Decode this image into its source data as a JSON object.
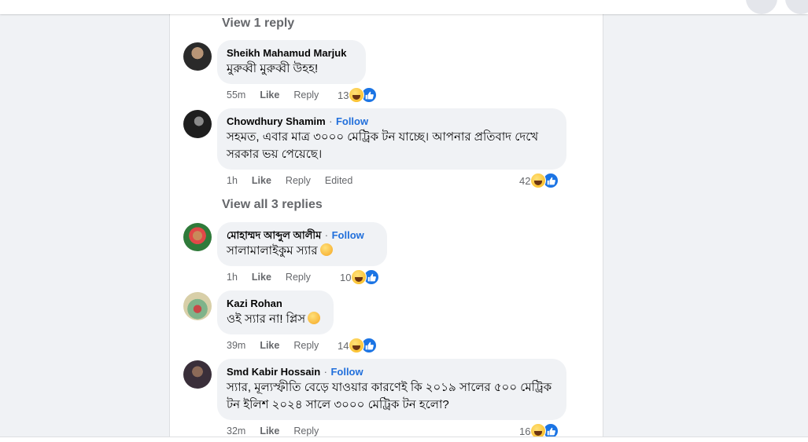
{
  "view_links": {
    "first": "View 1 reply",
    "second": "View all 3 replies"
  },
  "comments": [
    {
      "author": "Sheikh Mahamud Marjuk",
      "follow": "",
      "text_lines": [
        "মুরুব্বী মুরুব্বী উহহ!"
      ],
      "time": "55m",
      "like": "Like",
      "reply": "Reply",
      "edited": "",
      "reaction_count": "13"
    },
    {
      "author": "Chowdhury Shamim",
      "follow": "Follow",
      "text_lines": [
        "সহমত, এবার মাত্র ৩০০০ মেট্রিক টন যাচ্ছে। আপনার প্রতিবাদ দেখে",
        "সরকার ভয় পেয়েছে।"
      ],
      "time": "1h",
      "like": "Like",
      "reply": "Reply",
      "edited": "Edited",
      "reaction_count": "42"
    },
    {
      "author": "মোহাম্মদ আব্দুল আলীম",
      "follow": "Follow",
      "text_lines": [
        "সালামালাইকুম স্যার"
      ],
      "time": "1h",
      "like": "Like",
      "reply": "Reply",
      "edited": "",
      "reaction_count": "10"
    },
    {
      "author": "Kazi Rohan",
      "follow": "",
      "text_lines": [
        "ওই স্যার না! প্লিস"
      ],
      "time": "39m",
      "like": "Like",
      "reply": "Reply",
      "edited": "",
      "reaction_count": "14"
    },
    {
      "author": "Smd Kabir Hossain",
      "follow": "Follow",
      "text_lines": [
        "স্যার, মূল্যস্ফীতি বেড়ে যাওয়ার কারণেই কি ২০১৯ সালের ৫০০ মেট্রিক",
        "টন ইলিশ ২০২৪ সালে ৩০০০ মেট্রিক টন হলো?"
      ],
      "time": "32m",
      "like": "Like",
      "reply": "Reply",
      "edited": "",
      "reaction_count": "16"
    }
  ],
  "separator": "·",
  "icons": {
    "reaction_haha": "haha-reaction-icon",
    "reaction_like": "like-reaction-icon"
  },
  "colors": {
    "link_blue": "#216fdb",
    "like_blue": "#1b74e4",
    "bubble_bg": "#f0f2f5",
    "meta_gray": "#65676b"
  }
}
